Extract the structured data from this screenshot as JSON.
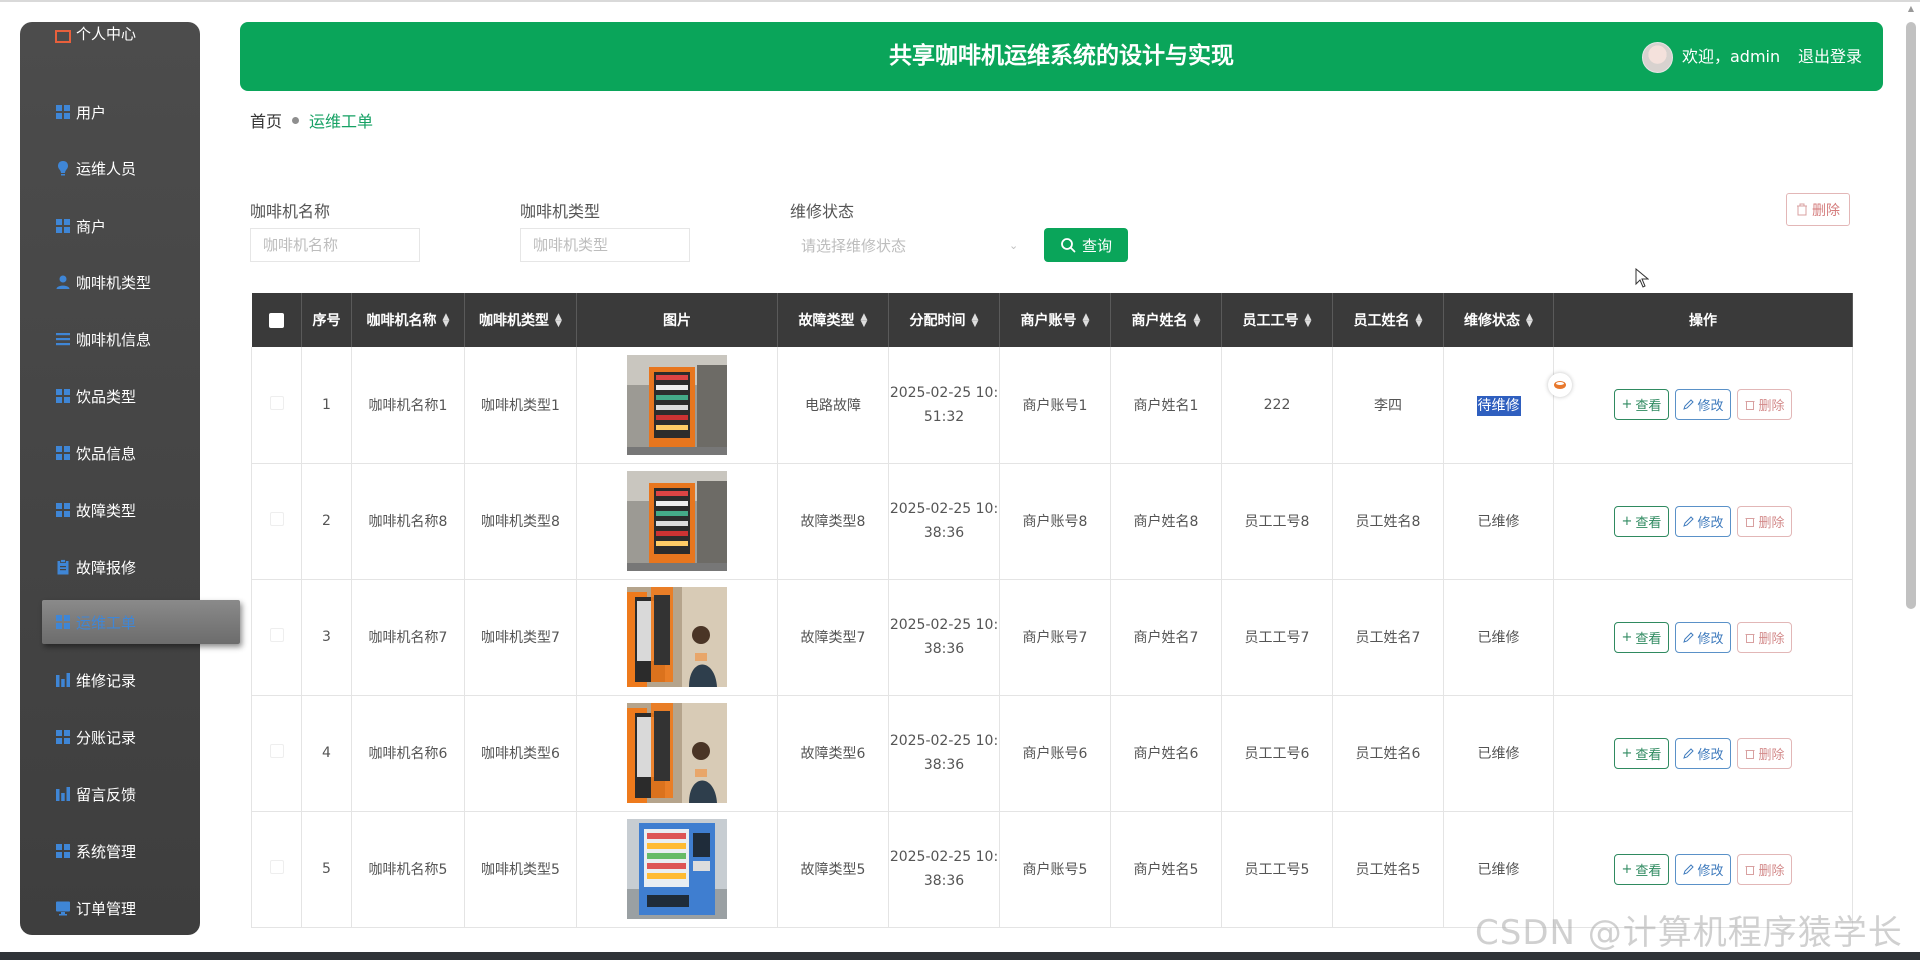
{
  "header": {
    "title": "共享咖啡机运维系统的设计与实现",
    "welcome": "欢迎，admin",
    "logout": "退出登录"
  },
  "sidebar": {
    "items": [
      {
        "label": "个人中心",
        "icon": "personal-center-icon"
      },
      {
        "label": "用户",
        "icon": "grid-icon"
      },
      {
        "label": "运维人员",
        "icon": "bulb-icon"
      },
      {
        "label": "商户",
        "icon": "grid-icon"
      },
      {
        "label": "咖啡机类型",
        "icon": "user-icon"
      },
      {
        "label": "咖啡机信息",
        "icon": "list-icon"
      },
      {
        "label": "饮品类型",
        "icon": "grid-icon"
      },
      {
        "label": "饮品信息",
        "icon": "grid-icon"
      },
      {
        "label": "故障类型",
        "icon": "grid-icon"
      },
      {
        "label": "故障报修",
        "icon": "clipboard-icon"
      },
      {
        "label": "运维工单",
        "icon": "grid-icon"
      },
      {
        "label": "维修记录",
        "icon": "bar-chart-icon"
      },
      {
        "label": "分账记录",
        "icon": "grid-icon"
      },
      {
        "label": "留言反馈",
        "icon": "bar-chart-icon"
      },
      {
        "label": "系统管理",
        "icon": "grid-icon"
      },
      {
        "label": "订单管理",
        "icon": "monitor-icon"
      }
    ],
    "active": "运维工单",
    "accent": "#3f86d6"
  },
  "breadcrumb": {
    "home": "首页",
    "current": "运维工单"
  },
  "search": {
    "name_label": "咖啡机名称",
    "name_placeholder": "咖啡机名称",
    "type_label": "咖啡机类型",
    "type_placeholder": "咖啡机类型",
    "status_label": "维修状态",
    "status_placeholder": "请选择维修状态",
    "query_button": "查询",
    "delete_button": "删除"
  },
  "table": {
    "headers": [
      "序号",
      "咖啡机名称",
      "咖啡机类型",
      "图片",
      "故障类型",
      "分配时间",
      "商户账号",
      "商户姓名",
      "员工工号",
      "员工姓名",
      "维修状态",
      "操作"
    ],
    "rows": [
      {
        "index": "1",
        "name": "咖啡机名称1",
        "type": "咖啡机类型1",
        "fault": "电路故障",
        "time": "2025-02-25 10:\n51:32",
        "account": "商户账号1",
        "merchant": "商户姓名1",
        "staff_id": "222",
        "staff_name": "李四",
        "status": "待维修",
        "image": "orange-machine"
      },
      {
        "index": "2",
        "name": "咖啡机名称8",
        "type": "咖啡机类型8",
        "fault": "故障类型8",
        "time": "2025-02-25 10:\n38:36",
        "account": "商户账号8",
        "merchant": "商户姓名8",
        "staff_id": "员工工号8",
        "staff_name": "员工姓名8",
        "status": "已维修",
        "image": "orange-machine"
      },
      {
        "index": "3",
        "name": "咖啡机名称7",
        "type": "咖啡机类型7",
        "fault": "故障类型7",
        "time": "2025-02-25 10:\n38:36",
        "account": "商户账号7",
        "merchant": "商户姓名7",
        "staff_id": "员工工号7",
        "staff_name": "员工姓名7",
        "status": "已维修",
        "image": "machine-with-person"
      },
      {
        "index": "4",
        "name": "咖啡机名称6",
        "type": "咖啡机类型6",
        "fault": "故障类型6",
        "time": "2025-02-25 10:\n38:36",
        "account": "商户账号6",
        "merchant": "商户姓名6",
        "staff_id": "员工工号6",
        "staff_name": "员工姓名6",
        "status": "已维修",
        "image": "machine-with-person"
      },
      {
        "index": "5",
        "name": "咖啡机名称5",
        "type": "咖啡机类型5",
        "fault": "故障类型5",
        "time": "2025-02-25 10:\n38:36",
        "account": "商户账号5",
        "merchant": "商户姓名5",
        "staff_id": "员工工号5",
        "staff_name": "员工姓名5",
        "status": "已维修",
        "image": "blue-machine"
      }
    ],
    "actions": {
      "view": "查看",
      "edit": "修改",
      "delete": "删除"
    }
  },
  "watermark": "CSDN @计算机程序猿学长",
  "colors": {
    "brand": "#0aa55a",
    "header_bg": "#3a3a3a",
    "highlight": "#2f5fbf"
  }
}
